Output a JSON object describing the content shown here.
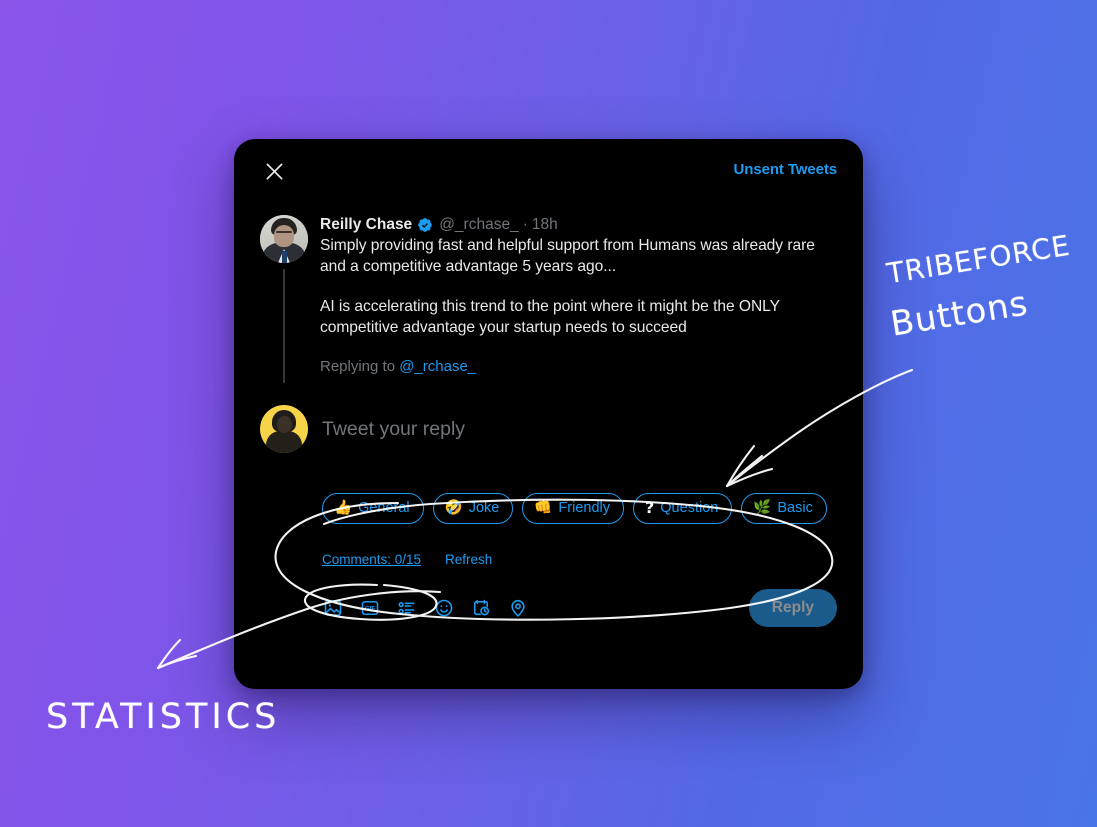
{
  "annotations": {
    "tribeforce": "TRIBEFORCE",
    "buttons": "Buttons",
    "statistics": "STATISTICS",
    "ink_color": "#ffffff"
  },
  "card": {
    "background": "#000000",
    "header": {
      "close_icon": "close-icon",
      "unsent_tweets_label": "Unsent Tweets"
    },
    "tweet": {
      "author_name": "Reilly Chase",
      "verified_icon": "verified-badge-icon",
      "handle": "@_rchase_",
      "separator": "·",
      "time": "18h",
      "paragraph_1": "Simply providing fast and helpful support from Humans was already rare and a competitive advantage 5 years ago...",
      "paragraph_2": "AI is accelerating this trend to the point where it might be the ONLY competitive advantage your startup needs to succeed",
      "replying_to_prefix": "Replying to",
      "replying_to_handle": "@_rchase_"
    },
    "compose": {
      "placeholder": "Tweet your reply"
    },
    "tribeforce_buttons": [
      {
        "emoji": "👍",
        "label": "General",
        "name": "general"
      },
      {
        "emoji": "🤣",
        "label": "Joke",
        "name": "joke"
      },
      {
        "emoji": "👊",
        "label": "Friendly",
        "name": "friendly"
      },
      {
        "emoji": "?",
        "label": "Question",
        "name": "question"
      },
      {
        "emoji": "🌿",
        "label": "Basic",
        "name": "basic"
      }
    ],
    "stats": {
      "comments_label": "Comments: 0/15",
      "comments_current": 0,
      "comments_total": 15,
      "refresh_label": "Refresh"
    },
    "action_bar": {
      "icons": [
        "image-icon",
        "gif-icon",
        "poll-icon",
        "emoji-icon",
        "schedule-icon",
        "location-icon"
      ],
      "reply_label": "Reply"
    }
  },
  "colors": {
    "accent_blue": "#1d9bf0",
    "muted_text": "#71767b",
    "primary_text": "#e7e9ea",
    "reply_button_bg": "#1b5b8c",
    "gradient_start": "#8b55ea",
    "gradient_end": "#4a75e5"
  }
}
